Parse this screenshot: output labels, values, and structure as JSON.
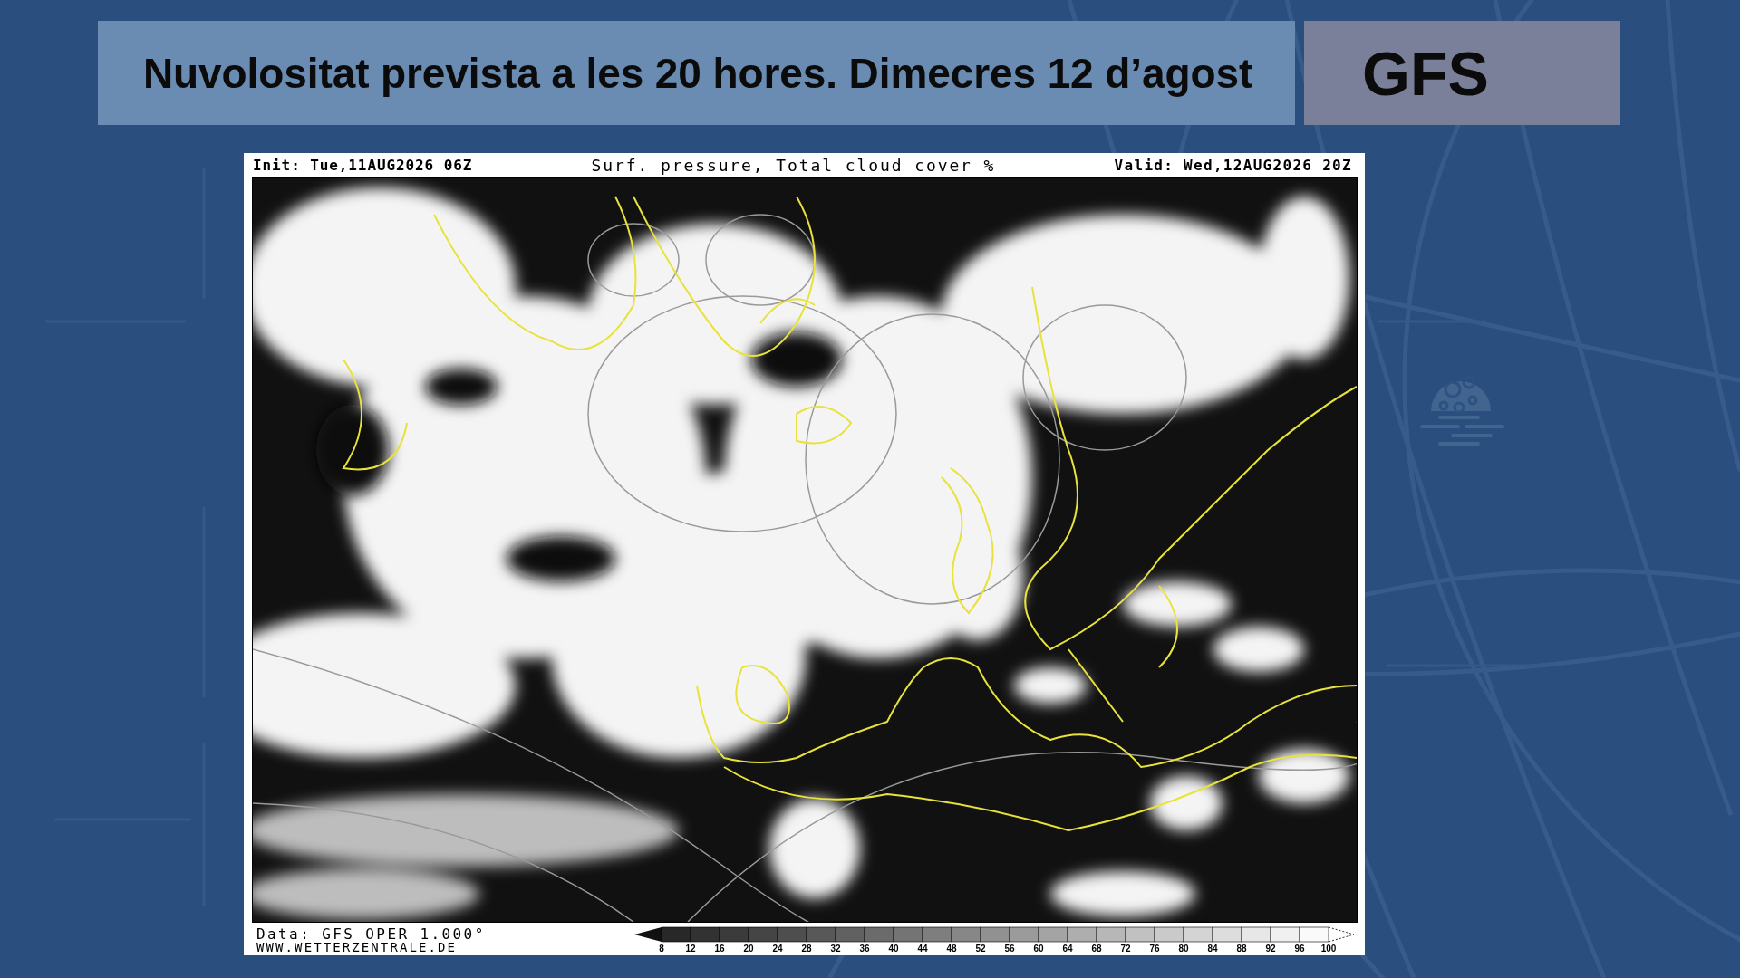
{
  "title": "Nuvolositat prevista a les 20 hores. Dimecres 12 d’agost",
  "model": "GFS",
  "map": {
    "init": "Init: Tue,11AUG2026 06Z",
    "heading": "Surf. pressure, Total cloud cover %",
    "valid": "Valid: Wed,12AUG2026 20Z",
    "data_source": "Data: GFS OPER 1.000°",
    "website": "WWW.WETTERZENTRALE.DE",
    "scale_labels": [
      "8",
      "12",
      "16",
      "20",
      "24",
      "28",
      "32",
      "36",
      "40",
      "44",
      "48",
      "52",
      "56",
      "60",
      "64",
      "68",
      "72",
      "76",
      "80",
      "84",
      "88",
      "92",
      "96",
      "100"
    ]
  }
}
